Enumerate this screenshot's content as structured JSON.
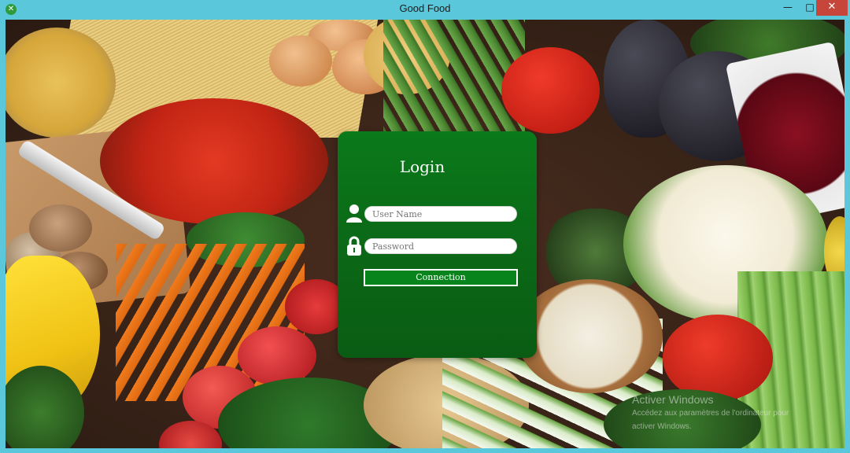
{
  "window": {
    "title": "Good Food",
    "controls": {
      "minimize": "—",
      "maximize": "□",
      "close": "✕"
    }
  },
  "login": {
    "title": "Login",
    "username_placeholder": "User Name",
    "password_placeholder": "Password",
    "button_label": "Connection",
    "icons": [
      "user-icon",
      "lock-icon"
    ],
    "accent": "#0a7a1a"
  },
  "watermark": {
    "line1": "Activer Windows",
    "line2": "Accédez aux paramètres de l'ordinateur pour",
    "line3": "activer Windows."
  }
}
